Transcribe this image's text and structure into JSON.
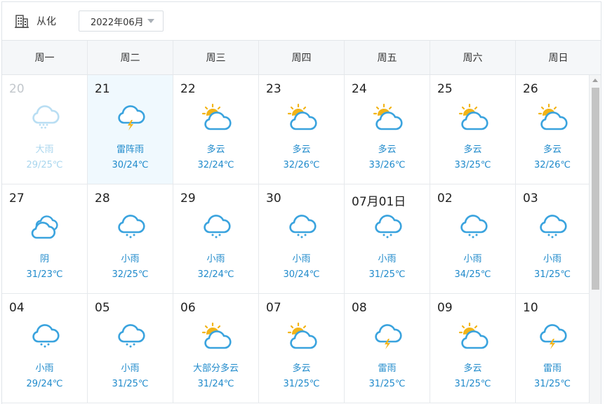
{
  "header": {
    "city": "从化",
    "city_icon": "building-icon",
    "month": "2022年06月"
  },
  "weekdays": [
    "周一",
    "周二",
    "周三",
    "周四",
    "周五",
    "周六",
    "周日"
  ],
  "colors": {
    "accent": "#1f8acb",
    "today_bg": "#f0f9fe",
    "past_text": "#a9d6ee",
    "sun": "#f2b418",
    "cloud": "#3aa3de"
  },
  "weeks": [
    [
      {
        "date": "20",
        "weather": "大雨",
        "temp": "29/25℃",
        "icon": "heavy-rain-icon",
        "state": "past"
      },
      {
        "date": "21",
        "weather": "雷阵雨",
        "temp": "30/24℃",
        "icon": "thunderstorm-icon",
        "state": "today"
      },
      {
        "date": "22",
        "weather": "多云",
        "temp": "32/24℃",
        "icon": "partly-cloudy-icon",
        "state": ""
      },
      {
        "date": "23",
        "weather": "多云",
        "temp": "32/26℃",
        "icon": "partly-cloudy-icon",
        "state": ""
      },
      {
        "date": "24",
        "weather": "多云",
        "temp": "33/26℃",
        "icon": "partly-cloudy-icon",
        "state": ""
      },
      {
        "date": "25",
        "weather": "多云",
        "temp": "33/25℃",
        "icon": "partly-cloudy-icon",
        "state": ""
      },
      {
        "date": "26",
        "weather": "多云",
        "temp": "32/26℃",
        "icon": "partly-cloudy-icon",
        "state": ""
      }
    ],
    [
      {
        "date": "27",
        "weather": "阴",
        "temp": "31/23℃",
        "icon": "overcast-icon",
        "state": ""
      },
      {
        "date": "28",
        "weather": "小雨",
        "temp": "32/25℃",
        "icon": "light-rain-icon",
        "state": ""
      },
      {
        "date": "29",
        "weather": "小雨",
        "temp": "32/24℃",
        "icon": "light-rain-icon",
        "state": ""
      },
      {
        "date": "30",
        "weather": "小雨",
        "temp": "30/24℃",
        "icon": "light-rain-icon",
        "state": ""
      },
      {
        "date": "07月01日",
        "weather": "小雨",
        "temp": "31/25℃",
        "icon": "light-rain-icon",
        "state": ""
      },
      {
        "date": "02",
        "weather": "小雨",
        "temp": "34/25℃",
        "icon": "light-rain-icon",
        "state": ""
      },
      {
        "date": "03",
        "weather": "小雨",
        "temp": "31/25℃",
        "icon": "light-rain-icon",
        "state": ""
      }
    ],
    [
      {
        "date": "04",
        "weather": "小雨",
        "temp": "29/24℃",
        "icon": "light-rain-icon",
        "state": ""
      },
      {
        "date": "05",
        "weather": "小雨",
        "temp": "31/25℃",
        "icon": "light-rain-icon",
        "state": ""
      },
      {
        "date": "06",
        "weather": "大部分多云",
        "temp": "31/24℃",
        "icon": "partly-cloudy-icon",
        "state": ""
      },
      {
        "date": "07",
        "weather": "多云",
        "temp": "31/25℃",
        "icon": "partly-cloudy-icon",
        "state": ""
      },
      {
        "date": "08",
        "weather": "雷雨",
        "temp": "31/25℃",
        "icon": "thunderstorm-icon",
        "state": ""
      },
      {
        "date": "09",
        "weather": "多云",
        "temp": "31/25℃",
        "icon": "partly-cloudy-icon",
        "state": ""
      },
      {
        "date": "10",
        "weather": "雷雨",
        "temp": "31/25℃",
        "icon": "thunderstorm-icon",
        "state": ""
      }
    ]
  ]
}
